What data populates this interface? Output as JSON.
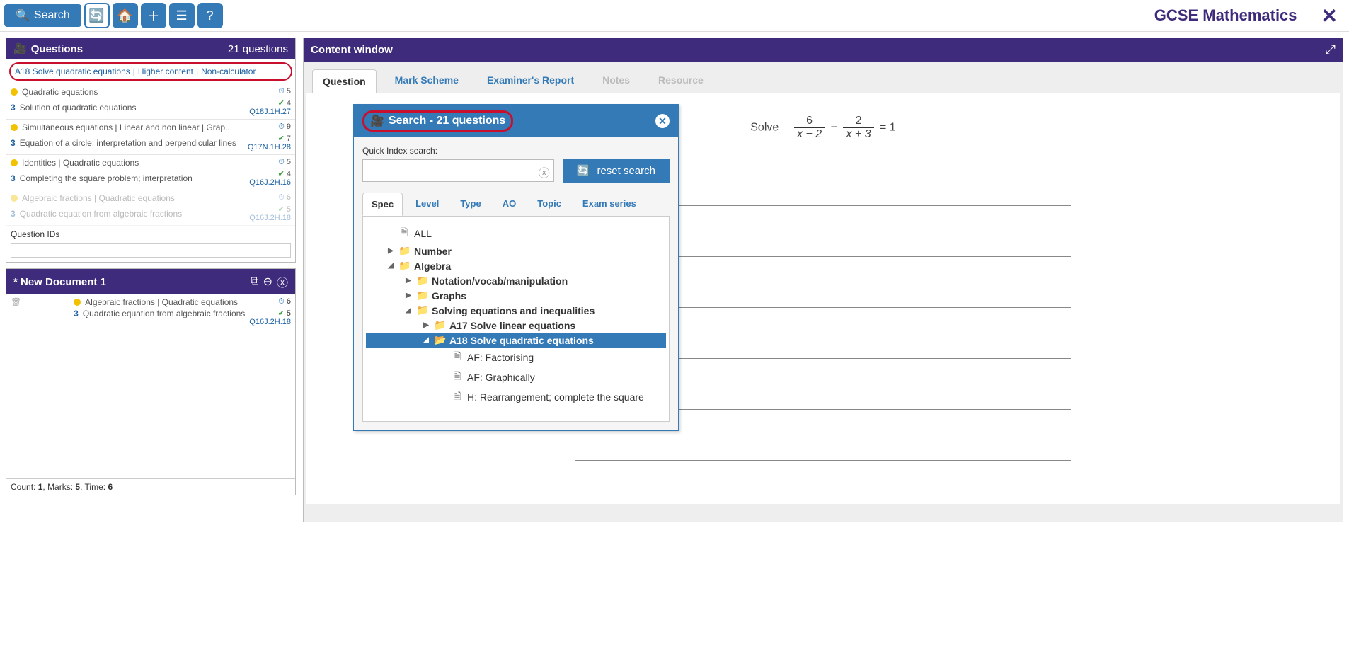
{
  "toolbar": {
    "search_label": "Search",
    "title": "GCSE Mathematics"
  },
  "questions_panel": {
    "title": "Questions",
    "count_text": "21 questions",
    "breadcrumb": [
      "A18 Solve quadratic equations",
      "Higher content",
      "Non-calculator"
    ],
    "items": [
      {
        "title": "Quadratic equations",
        "sub": "Solution of quadratic equations",
        "marks": "3",
        "clock": "5",
        "check": "4",
        "qid": "Q18J.1H.27",
        "faded": false
      },
      {
        "title": "Simultaneous equations | Linear and non linear | Grap...",
        "sub": "Equation of a circle; interpretation and perpendicular lines",
        "marks": "3",
        "clock": "9",
        "check": "7",
        "qid": "Q17N.1H.28",
        "faded": false
      },
      {
        "title": "Identities | Quadratic equations",
        "sub": "Completing the square problem; interpretation",
        "marks": "3",
        "clock": "5",
        "check": "4",
        "qid": "Q16J.2H.16",
        "faded": false
      },
      {
        "title": "Algebraic fractions | Quadratic equations",
        "sub": "Quadratic equation from algebraic fractions",
        "marks": "3",
        "clock": "6",
        "check": "5",
        "qid": "Q16J.2H.18",
        "faded": true
      }
    ],
    "ids_label": "Question IDs"
  },
  "document_panel": {
    "title": "* New Document 1",
    "items": [
      {
        "title": "Algebraic fractions | Quadratic equations",
        "sub": "Quadratic equation from algebraic fractions",
        "marks": "3",
        "clock": "6",
        "check": "5",
        "qid": "Q16J.2H.18"
      }
    ],
    "footer_count_label": "Count:",
    "footer_count": "1",
    "footer_marks_label": "Marks:",
    "footer_marks": "5",
    "footer_time_label": "Time:",
    "footer_time": "6"
  },
  "content_panel": {
    "title": "Content window",
    "tabs": [
      "Question",
      "Mark Scheme",
      "Examiner's Report",
      "Notes",
      "Resource"
    ],
    "active_tab": 0,
    "eq_word": "Solve",
    "eq_n1": "6",
    "eq_d1": "x − 2",
    "eq_minus": "−",
    "eq_n2": "2",
    "eq_d2": "x + 3",
    "eq_rhs": "= 1"
  },
  "search_modal": {
    "header": "Search - 21 questions",
    "quick_label": "Quick Index search:",
    "reset_label": "reset search",
    "tabs": [
      "Spec",
      "Level",
      "Type",
      "AO",
      "Topic",
      "Exam series"
    ],
    "active_tab": 0,
    "tree": [
      {
        "lv": 0,
        "icon": "doc",
        "label": "ALL",
        "tri": ""
      },
      {
        "lv": 1,
        "icon": "folder",
        "label": "Number",
        "tri": "▶"
      },
      {
        "lv": 1,
        "icon": "folder",
        "label": "Algebra",
        "tri": "◢"
      },
      {
        "lv": 2,
        "icon": "folder",
        "label": "Notation/vocab/manipulation",
        "tri": "▶"
      },
      {
        "lv": 2,
        "icon": "folder",
        "label": "Graphs",
        "tri": "▶"
      },
      {
        "lv": 2,
        "icon": "folder",
        "label": "Solving equations and inequalities",
        "tri": "◢"
      },
      {
        "lv": 3,
        "icon": "folder",
        "label": "A17 Solve linear equations",
        "tri": "▶",
        "class": "lv3b"
      },
      {
        "lv": 3,
        "icon": "folder-open",
        "label": "A18 Solve quadratic equations",
        "tri": "◢",
        "class": "lv3b selected"
      },
      {
        "lv": 4,
        "icon": "doc",
        "label": "AF: Factorising",
        "tri": ""
      },
      {
        "lv": 4,
        "icon": "doc",
        "label": "AF: Graphically",
        "tri": ""
      },
      {
        "lv": 4,
        "icon": "doc",
        "label": "H: Rearrangement; complete the square",
        "tri": ""
      }
    ]
  }
}
